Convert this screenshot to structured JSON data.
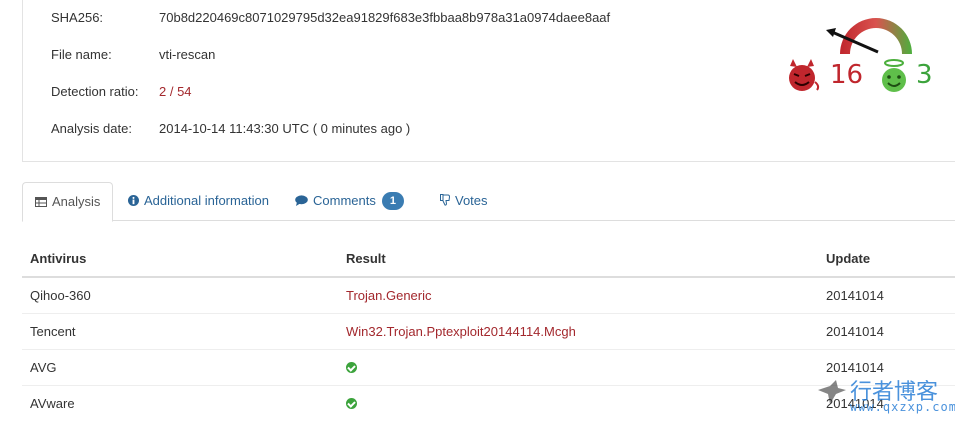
{
  "file_info": {
    "rows": [
      {
        "label": "SHA256:",
        "value": "70b8d220469c8071029795d32ea91829f683e3fbbaa8b978a31a0974daee8aaf"
      },
      {
        "label": "File name:",
        "value": "vti-rescan"
      },
      {
        "label": "Detection ratio:",
        "value": "2 / 54"
      },
      {
        "label": "Analysis date:",
        "value": "2014-10-14 11:43:30 UTC ( 0 minutes ago )"
      }
    ]
  },
  "score": {
    "malicious": "16",
    "harmless": "3",
    "colors": {
      "malicious": "#c0262d",
      "harmless": "#3ca33c"
    }
  },
  "tabs": [
    {
      "label": "Analysis",
      "icon": "table-icon"
    },
    {
      "label": "Additional information",
      "icon": "info-circle-icon"
    },
    {
      "label": "Comments",
      "icon": "comment-icon",
      "badge": "1"
    },
    {
      "label": "Votes",
      "icon": "thumbs-down-icon"
    }
  ],
  "table": {
    "headers": [
      "Antivirus",
      "Result",
      "Update"
    ],
    "rows": [
      {
        "antivirus": "Qihoo-360",
        "result": "Trojan.Generic",
        "update": "20141014"
      },
      {
        "antivirus": "Tencent",
        "result": "Win32.Trojan.Pptexploit20144114.Mcgh",
        "update": "20141014"
      },
      {
        "antivirus": "AVG",
        "result": "",
        "result_icon": "check-circle-icon",
        "update": "20141014"
      },
      {
        "antivirus": "AVware",
        "result": "",
        "result_icon": "check-circle-icon",
        "update": "20141014"
      }
    ]
  },
  "watermark": {
    "title": "行者博客",
    "url": "www.qxzxp.com"
  }
}
